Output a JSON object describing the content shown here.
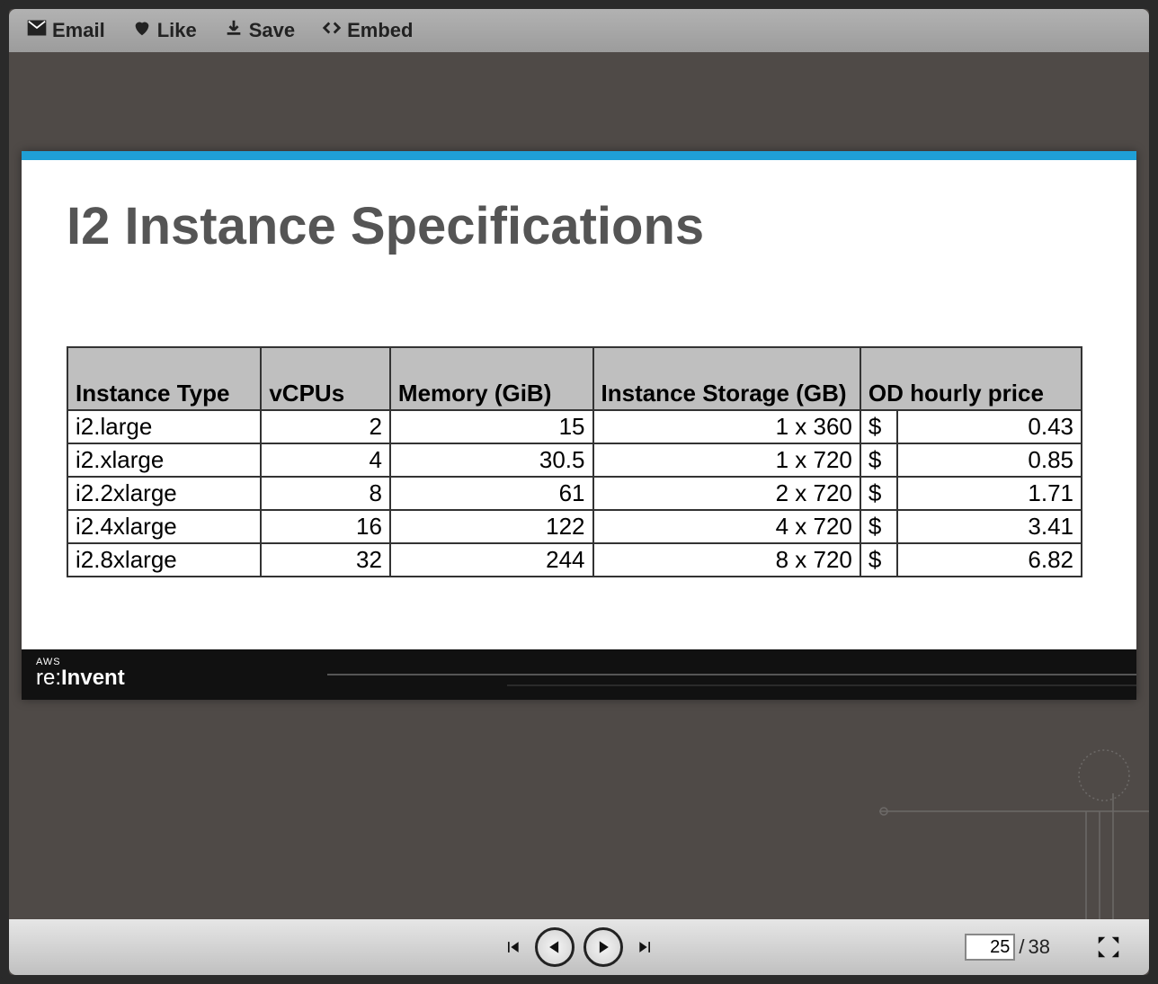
{
  "toolbar": {
    "email_label": "Email",
    "like_label": "Like",
    "save_label": "Save",
    "embed_label": "Embed"
  },
  "slide": {
    "title": "I2 Instance Specifications",
    "footer_brand_prefix": "AWS",
    "footer_brand_re": "re:",
    "footer_brand_main": "Invent",
    "table": {
      "headers": {
        "type": "Instance Type",
        "vcpus": "vCPUs",
        "memory": "Memory (GiB)",
        "storage": "Instance Storage (GB)",
        "price": "OD hourly price"
      },
      "currency": "$",
      "rows": [
        {
          "type": "i2.large",
          "vcpus": "2",
          "memory": "15",
          "storage": "1 x 360",
          "price": "0.43"
        },
        {
          "type": "i2.xlarge",
          "vcpus": "4",
          "memory": "30.5",
          "storage": "1 x 720",
          "price": "0.85"
        },
        {
          "type": "i2.2xlarge",
          "vcpus": "8",
          "memory": "61",
          "storage": "2 x 720",
          "price": "1.71"
        },
        {
          "type": "i2.4xlarge",
          "vcpus": "16",
          "memory": "122",
          "storage": "4 x 720",
          "price": "3.41"
        },
        {
          "type": "i2.8xlarge",
          "vcpus": "32",
          "memory": "244",
          "storage": "8 x 720",
          "price": "6.82"
        }
      ]
    }
  },
  "player": {
    "current_page": "25",
    "total_pages": "38",
    "separator": "/"
  },
  "chart_data": {
    "type": "table",
    "title": "I2 Instance Specifications",
    "columns": [
      "Instance Type",
      "vCPUs",
      "Memory (GiB)",
      "Instance Storage (GB)",
      "OD hourly price ($)"
    ],
    "rows": [
      [
        "i2.large",
        2,
        15,
        "1 x 360",
        0.43
      ],
      [
        "i2.xlarge",
        4,
        30.5,
        "1 x 720",
        0.85
      ],
      [
        "i2.2xlarge",
        8,
        61,
        "2 x 720",
        1.71
      ],
      [
        "i2.4xlarge",
        16,
        122,
        "4 x 720",
        3.41
      ],
      [
        "i2.8xlarge",
        32,
        244,
        "8 x 720",
        6.82
      ]
    ]
  }
}
